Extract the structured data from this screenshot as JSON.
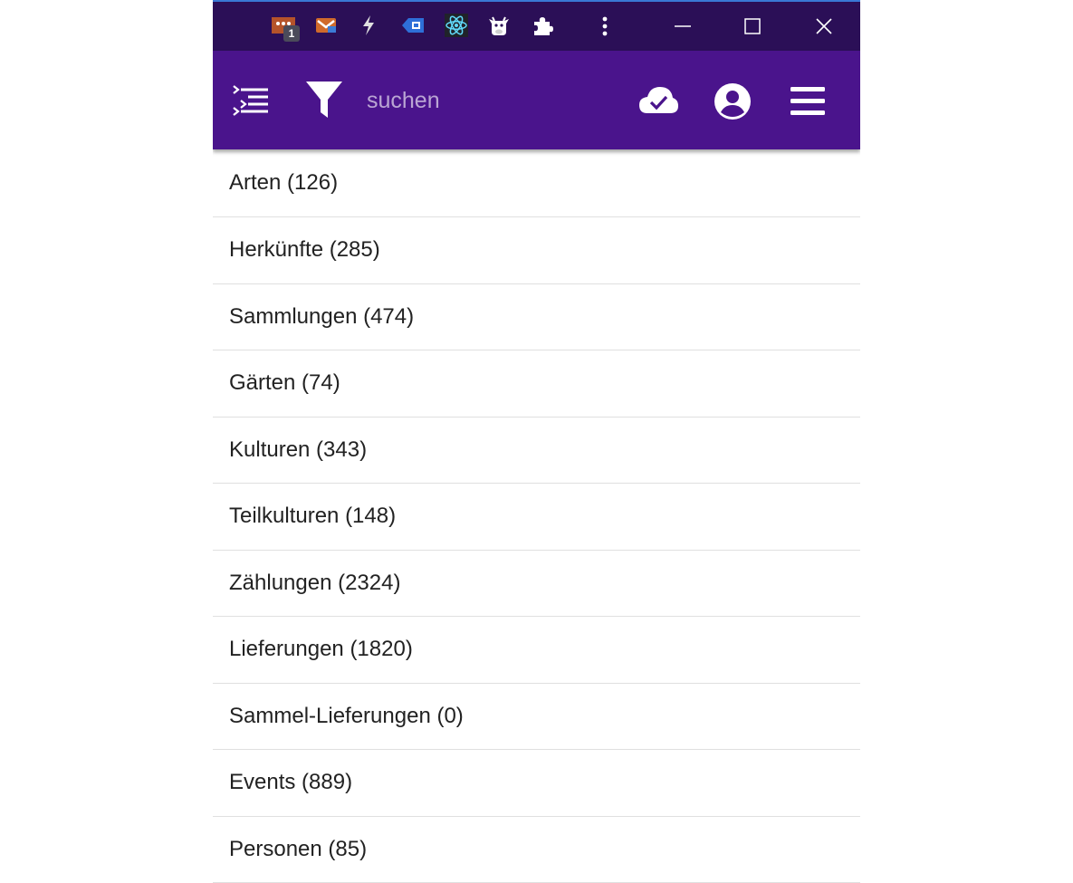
{
  "titlebar": {
    "background": "#2b0f57",
    "extensions": [
      {
        "icon": "flame-extension-icon",
        "badge": "1"
      },
      {
        "icon": "mail-extension-icon"
      },
      {
        "icon": "lightning-extension-icon"
      },
      {
        "icon": "tag-extension-icon"
      },
      {
        "icon": "react-devtools-icon"
      },
      {
        "icon": "cow-extension-icon"
      },
      {
        "icon": "puzzle-extensions-icon"
      }
    ],
    "window_controls": [
      "kebab-menu-icon",
      "minimize-icon",
      "maximize-icon",
      "close-icon"
    ]
  },
  "appbar": {
    "background": "#4a148c",
    "search": {
      "placeholder": "suchen",
      "value": ""
    },
    "left_icons": [
      "tree-list-icon",
      "filter-icon"
    ],
    "right_icons": [
      "cloud-done-icon",
      "account-icon",
      "menu-icon"
    ]
  },
  "list": {
    "items": [
      {
        "label": "Arten (126)"
      },
      {
        "label": "Herkünfte (285)"
      },
      {
        "label": "Sammlungen (474)"
      },
      {
        "label": "Gärten (74)"
      },
      {
        "label": "Kulturen (343)"
      },
      {
        "label": "Teilkulturen (148)"
      },
      {
        "label": "Zählungen (2324)"
      },
      {
        "label": "Lieferungen (1820)"
      },
      {
        "label": "Sammel-Lieferungen (0)"
      },
      {
        "label": "Events (889)"
      },
      {
        "label": "Personen (85)"
      }
    ]
  }
}
